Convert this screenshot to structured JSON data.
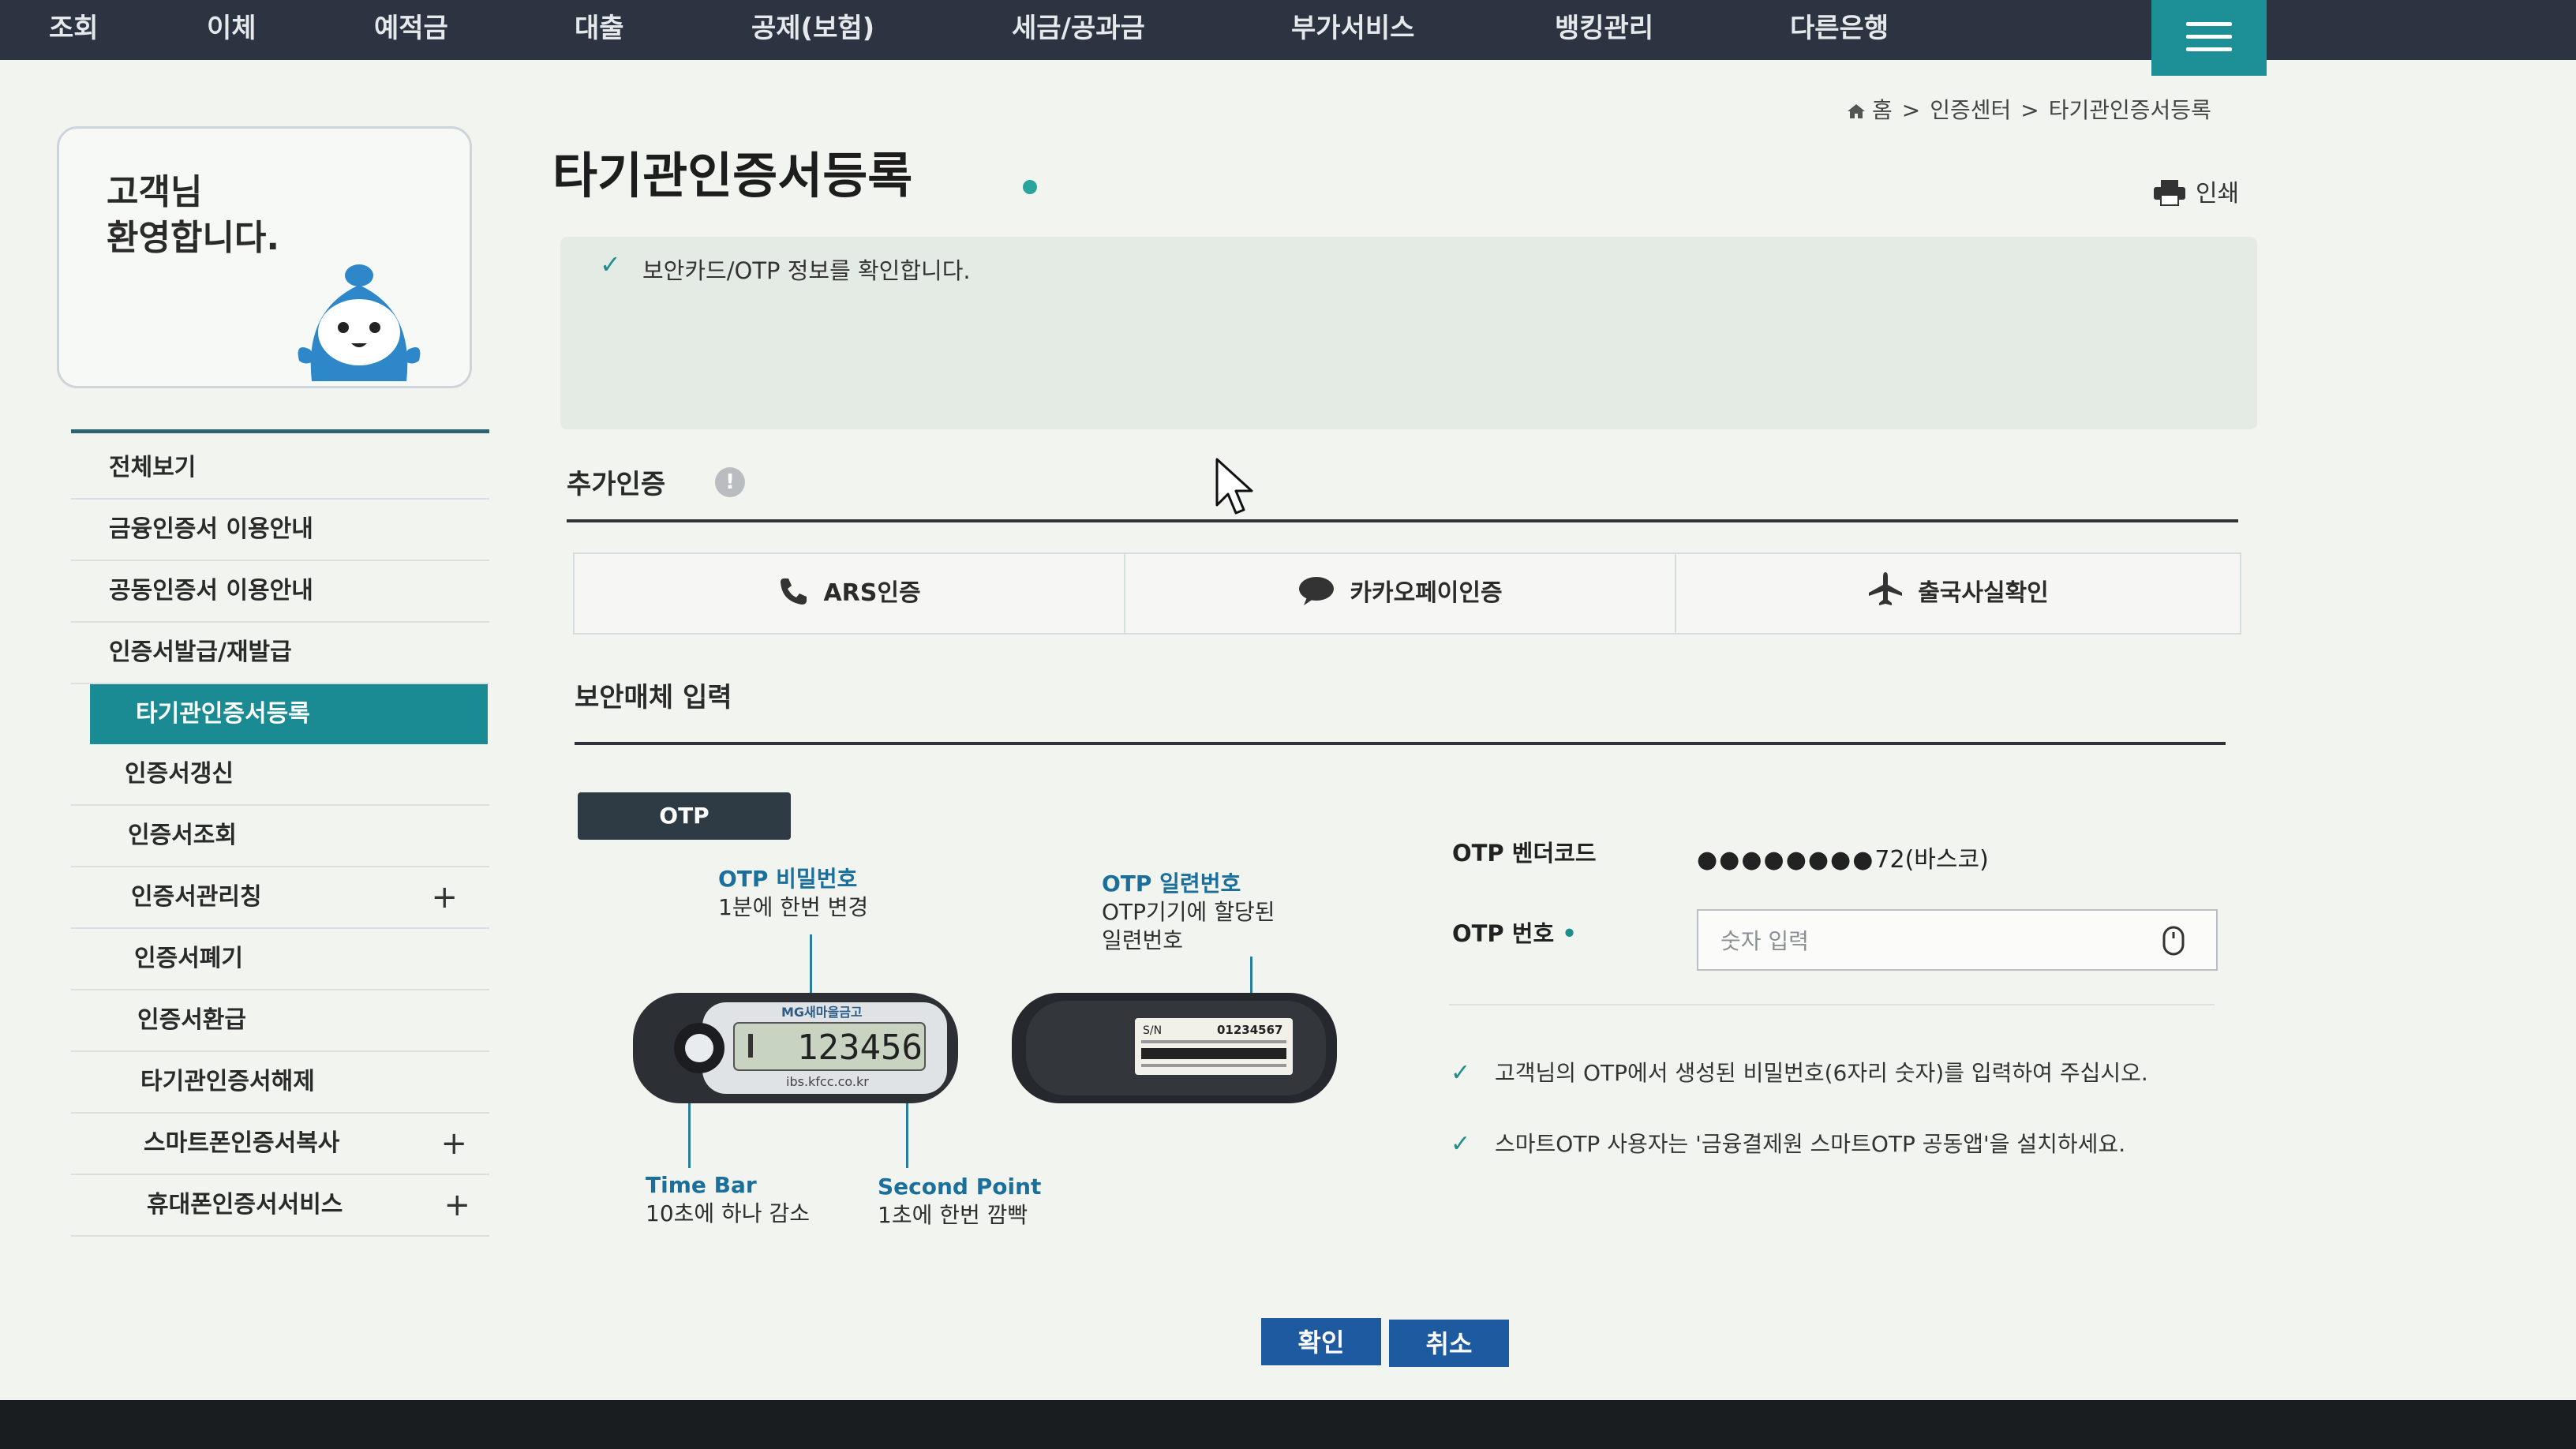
{
  "nav": {
    "items": [
      "조회",
      "이체",
      "예적금",
      "대출",
      "공제(보험)",
      "세금/공과금",
      "부가서비스",
      "뱅킹관리",
      "다른은행"
    ]
  },
  "breadcrumb": {
    "home": "홈",
    "level1": "인증센터",
    "level2": "타기관인증서등록"
  },
  "welcome": {
    "line1": "고객님",
    "line2": "환영합니다."
  },
  "sidebar": {
    "items": [
      {
        "label": "전체보기"
      },
      {
        "label": "금융인증서 이용안내"
      },
      {
        "label": "공동인증서 이용안내"
      },
      {
        "label": "인증서발급/재발급"
      },
      {
        "label": "타기관인증서등록",
        "active": true
      },
      {
        "label": "인증서갱신"
      },
      {
        "label": "인증서조회"
      },
      {
        "label": "인증서관리칭",
        "expand": "+"
      },
      {
        "label": "인증서폐기"
      },
      {
        "label": "인증서환급"
      },
      {
        "label": "타기관인증서해제"
      },
      {
        "label": "스마트폰인증서복사",
        "expand": "+"
      },
      {
        "label": "휴대폰인증서서비스",
        "expand": "+"
      }
    ]
  },
  "main": {
    "title": "타기관인증서등록",
    "print_label": "인쇄",
    "notice": "보안카드/OTP 정보를 확인합니다.",
    "extra_auth": {
      "title": "추가인증",
      "info_glyph": "!",
      "options": [
        "ARS인증",
        "카카오페이인증",
        "출국사실확인"
      ]
    },
    "media": {
      "title": "보안매체 입력",
      "tab": "OTP",
      "captions": {
        "pin_title": "OTP 비밀번호",
        "pin_desc": "1분에 한번 변경",
        "serial_title": "OTP 일련번호",
        "serial_desc1": "OTP기기에 할당된",
        "serial_desc2": "일련번호",
        "timebar_title": "Time Bar",
        "timebar_desc": "10초에 하나 감소",
        "second_title": "Second Point",
        "second_desc": "1초에 한번 깜빡"
      },
      "device": {
        "brand": "MG새마을금고",
        "code": "123456",
        "url": "ibs.kfcc.co.kr",
        "sn_label": "S/N",
        "sn_value": "01234567"
      },
      "vendor_label": "OTP 벤더코드",
      "vendor_dots": "●●●●●●●●",
      "vendor_value": "72(바스코)",
      "otp_label": "OTP 번호",
      "otp_placeholder": "숫자 입력",
      "guides": [
        "고객님의 OTP에서 생성된 비밀번호(6자리 숫자)를 입력하여 주십시오.",
        "스마트OTP 사용자는 '금융결제원 스마트OTP 공동앱'을 설치하세요."
      ]
    },
    "buttons": {
      "confirm": "확인",
      "cancel": "취소"
    }
  },
  "colors": {
    "nav_bg": "#2b3440",
    "accent_teal": "#1a8b93",
    "primary_button": "#1e5aa0"
  }
}
